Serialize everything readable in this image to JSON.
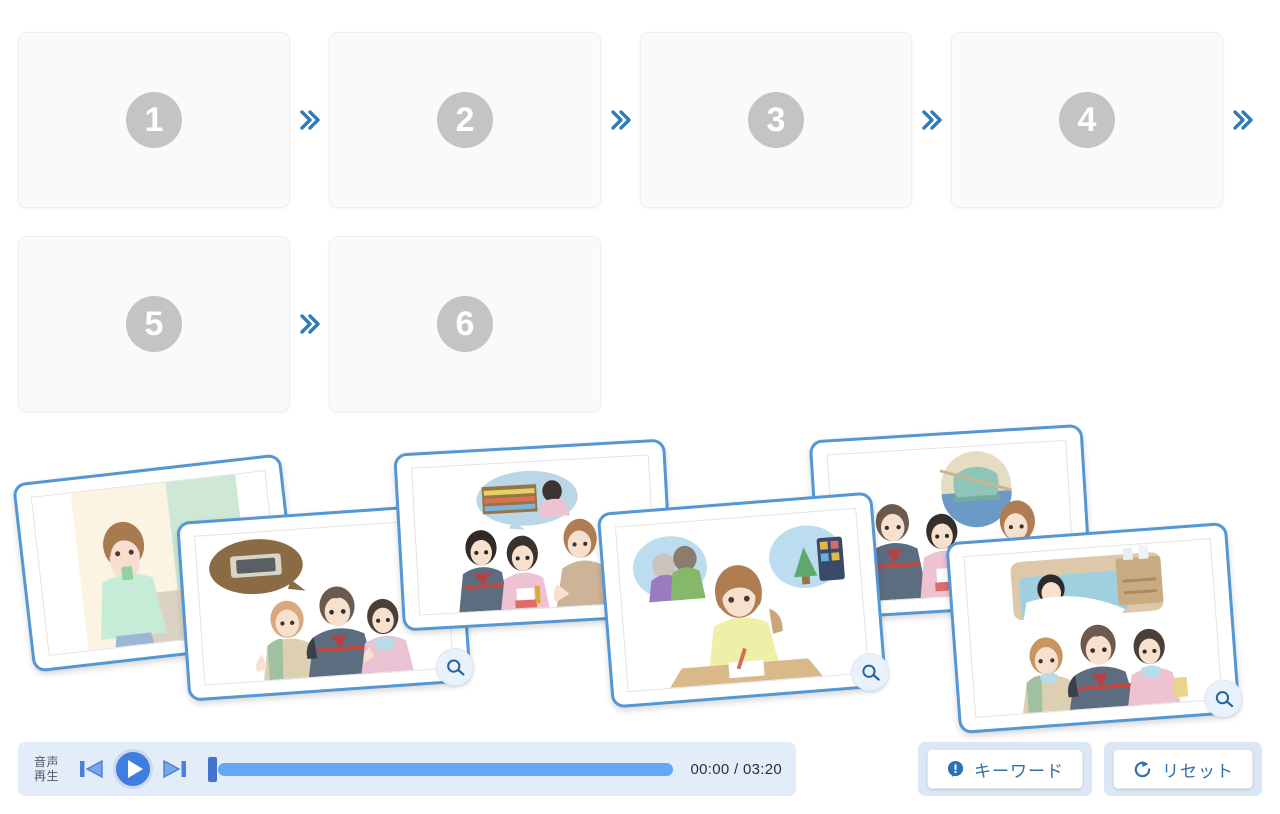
{
  "sequence": {
    "separator_icon": "double-chevron-right-icon",
    "slots": [
      {
        "number": "1"
      },
      {
        "number": "2"
      },
      {
        "number": "3"
      },
      {
        "number": "4"
      },
      {
        "number": "5"
      },
      {
        "number": "6"
      }
    ]
  },
  "tray": {
    "zoom_icon": "magnifier-icon",
    "cards": [
      {
        "id": "card-1",
        "alt": "Woman in mint sweater holding a phone indoors"
      },
      {
        "id": "card-2",
        "alt": "Three students looking at a thought bubble showing a tray of food"
      },
      {
        "id": "card-3",
        "alt": "Two students talking with a woman, thought bubble of a shop shelf"
      },
      {
        "id": "card-4",
        "alt": "Girl writing at a desk with thought bubbles of grandparents and a christmas tree"
      },
      {
        "id": "card-5",
        "alt": "Boy and girl with woman, circular inset of a green cap"
      },
      {
        "id": "card-6",
        "alt": "Three students looking at a thought bubble of a person resting in bed"
      }
    ]
  },
  "player": {
    "label_line1": "音声",
    "label_line2": "再生",
    "prev_icon": "skip-previous-icon",
    "play_icon": "play-circle-icon",
    "next_icon": "skip-next-icon",
    "progress_percent": 0,
    "time_display": "00:00 / 03:20"
  },
  "actions": {
    "keyword": {
      "label": "キーワード",
      "icon": "exclamation-bubble-icon"
    },
    "reset": {
      "label": "リセット",
      "icon": "refresh-icon"
    }
  },
  "colors": {
    "accent_blue": "#2f7cb8",
    "card_border": "#5596d4",
    "slot_fill": "#fafafa",
    "slot_number_circle": "#c4c4c4",
    "player_bg": "#e3ecf9",
    "progress_fill": "#63a8f5",
    "progress_thumb": "#4175cf",
    "action_pad": "#dbe7f7",
    "action_text": "#2f6fa8"
  }
}
